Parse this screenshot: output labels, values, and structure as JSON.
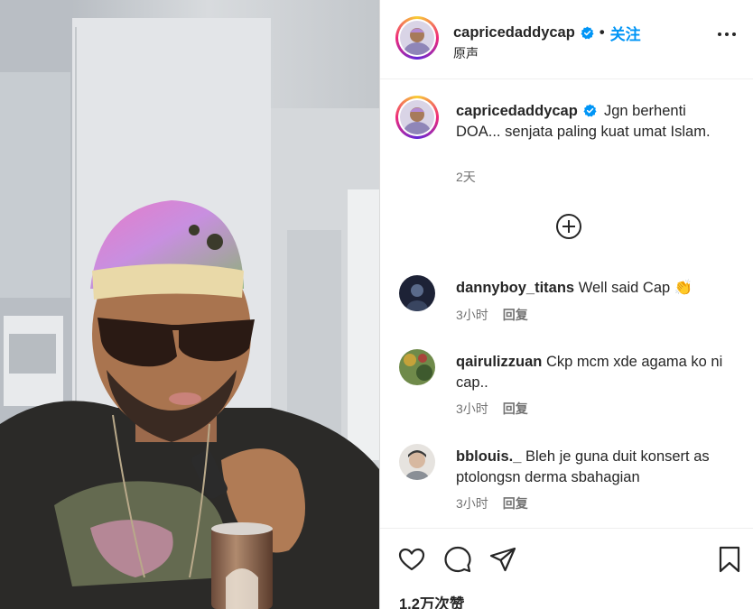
{
  "post": {
    "username": "capricedaddycap",
    "separator": "•",
    "follow_label": "关注",
    "audio_label": "原声"
  },
  "caption": {
    "username": "capricedaddycap",
    "text": "Jgn berhenti DOA... senjata paling kuat umat Islam.",
    "time": "2天"
  },
  "comments": [
    {
      "username": "dannyboy_titans",
      "text": "Well said Cap 👏",
      "time": "3小时",
      "reply_label": "回复"
    },
    {
      "username": "qairulizzuan",
      "text": "Ckp mcm xde agama ko ni cap..",
      "time": "3小时",
      "reply_label": "回复"
    },
    {
      "username": "bblouis._",
      "text": "Bleh je guna duit konsert as ptolongsn derma sbahagian",
      "time": "3小时",
      "reply_label": "回复"
    }
  ],
  "footer": {
    "likes_label": "1.2万次赞"
  },
  "icons": {
    "verified": "verified-badge-icon",
    "more": "more-options-icon",
    "load_more": "plus-circle-icon",
    "like": "heart-icon",
    "comment": "comment-bubble-icon",
    "share": "paper-plane-icon",
    "save": "bookmark-icon"
  },
  "colors": {
    "accent": "#0095f6",
    "verified": "#0095f6",
    "text": "#262626",
    "muted": "#737373"
  }
}
